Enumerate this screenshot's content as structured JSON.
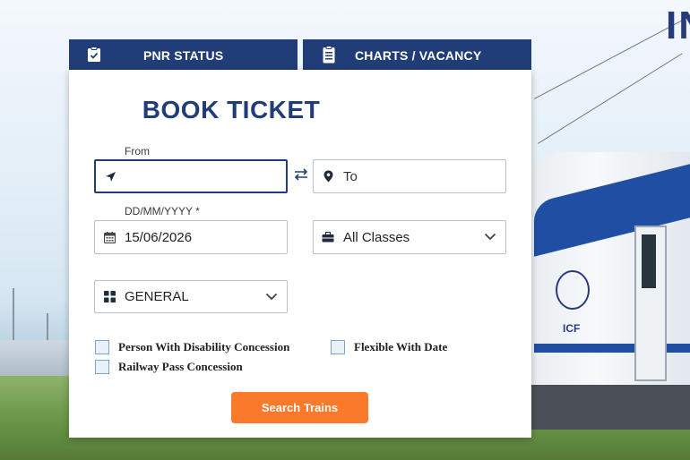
{
  "header": {
    "brand_partial": "IN"
  },
  "tabs": [
    {
      "label": "PNR STATUS",
      "icon": "clipboard-check-icon"
    },
    {
      "label": "CHARTS / VACANCY",
      "icon": "chart-sheet-icon"
    }
  ],
  "form": {
    "title": "BOOK TICKET",
    "from": {
      "label": "From",
      "value": "",
      "icon": "location-arrow-icon"
    },
    "to": {
      "placeholder": "To",
      "icon": "map-pin-icon"
    },
    "date": {
      "label": "DD/MM/YYYY *",
      "value": "15/06/2026",
      "icon": "calendar-icon"
    },
    "class_select": {
      "value": "All Classes",
      "icon": "briefcase-icon"
    },
    "quota_select": {
      "value": "GENERAL",
      "icon": "grid-icon"
    },
    "checkboxes": [
      {
        "label": "Person With Disability Concession",
        "checked": false
      },
      {
        "label": "Flexible With Date",
        "checked": false
      },
      {
        "label": "Railway Pass Concession",
        "checked": false
      }
    ],
    "search_button": "Search Trains"
  },
  "colors": {
    "primary": "#213d77",
    "accent": "#fb792b"
  }
}
